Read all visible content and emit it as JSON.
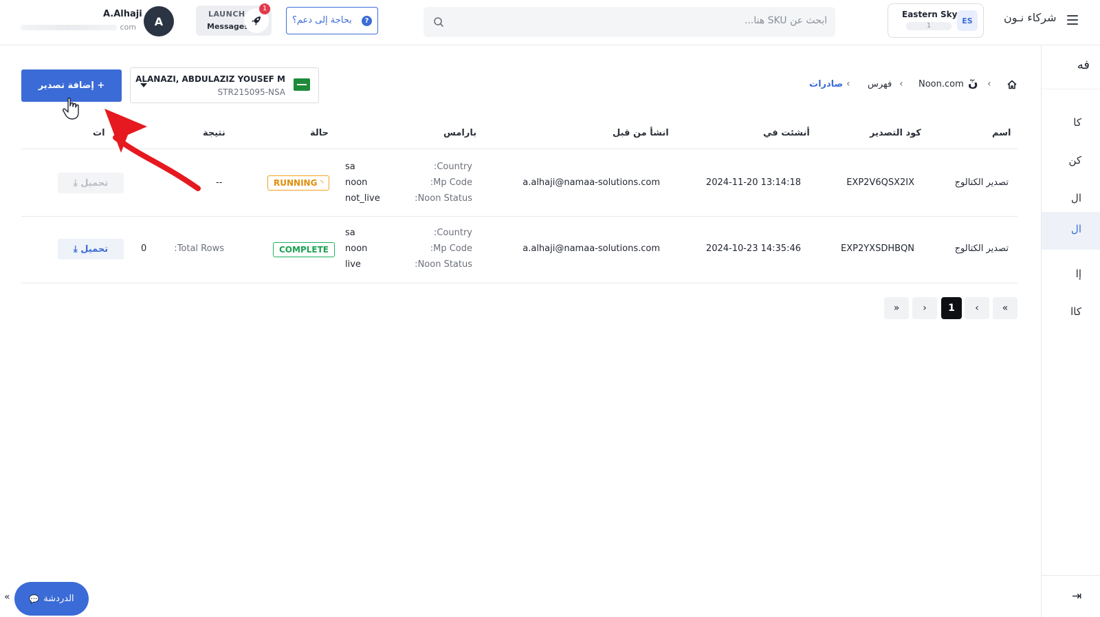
{
  "header": {
    "brand": "شركاء نـون",
    "store": {
      "badge": "ES",
      "name": "Eastern Sky",
      "sub": "1"
    },
    "search_placeholder": "ابحث عن SKU هنا...",
    "help_label": "بحاجة إلى دعم؟",
    "help_icon": "?",
    "launch_title": "LAUNCH",
    "launch_sub": "Messages",
    "notification_count": "1",
    "user": {
      "initial": "A",
      "name": "A.Alhaji",
      "email_suffix": "com"
    }
  },
  "sidebar": {
    "top_label": "فه",
    "items": [
      {
        "label": "كا"
      },
      {
        "label": "كن"
      },
      {
        "label": "ال"
      },
      {
        "label": "ال"
      },
      {
        "label": "إا"
      },
      {
        "label": "كاا"
      }
    ],
    "collapse_icon": "⇥"
  },
  "breadcrumb": {
    "items": [
      "Noon.com",
      "فهرس",
      "صادرات"
    ],
    "logo": "نٓ"
  },
  "toolbar": {
    "add_export_label": "+ إضافة تصدير",
    "seller": {
      "name": "ALANAZI, ABDULAZIZ YOUSEF M",
      "id": "STR215095-NSA"
    }
  },
  "table": {
    "headers": {
      "name": "اسم",
      "code": "كود التصدير",
      "created_at": "أنشئت في",
      "created_by": "انشأ من قبل",
      "params": "بارامس",
      "status": "حالة",
      "result": "نتيجة",
      "actions": "ات"
    },
    "rows": [
      {
        "name": "تصدير الكتالوج",
        "code": "EXP2V6QSX2IX",
        "created_at": "2024-11-20 13:14:18",
        "created_by": "a.alhaji@namaa-solutions.com",
        "params": [
          {
            "key": "Country:",
            "value": "sa"
          },
          {
            "key": "Mp Code:",
            "value": "noon"
          },
          {
            "key": "Noon Status:",
            "value": "not_live"
          }
        ],
        "status": "RUNNING",
        "result_label": "",
        "result_value": "--",
        "download_label": "تحميل ⤓"
      },
      {
        "name": "تصدير الكتالوج",
        "code": "EXP2YXSDHBQN",
        "created_at": "2024-10-23 14:35:46",
        "created_by": "a.alhaji@namaa-solutions.com",
        "params": [
          {
            "key": "Country:",
            "value": "sa"
          },
          {
            "key": "Mp Code:",
            "value": "noon"
          },
          {
            "key": "Noon Status:",
            "value": "live"
          }
        ],
        "status": "COMPLETE",
        "result_label": "Total Rows:",
        "result_value": "0",
        "download_label": "تحميل ⤓"
      }
    ]
  },
  "pagination": {
    "first": "«",
    "prev": "‹",
    "current": "1",
    "next": "›",
    "last": "»"
  },
  "chat": {
    "label": "الدردشة",
    "expand": "«"
  },
  "colors": {
    "primary": "#3b6bd6",
    "running": "#f0a021",
    "complete": "#19b15b",
    "annotation_arrow": "#e5191f"
  }
}
